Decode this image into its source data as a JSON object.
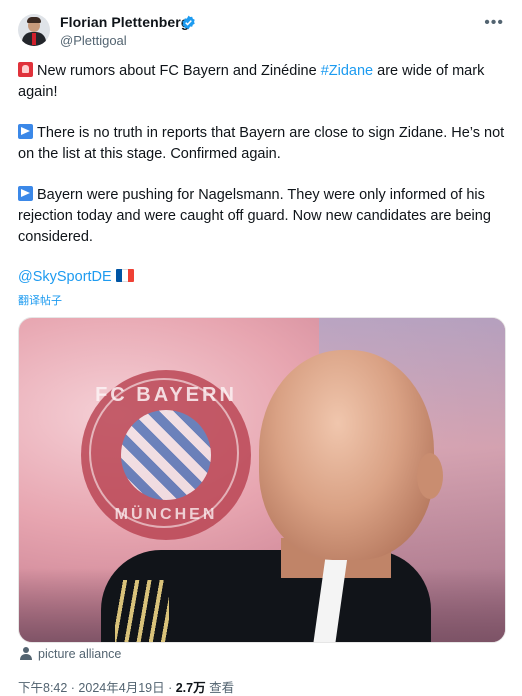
{
  "author": {
    "name": "Florian Plettenberg",
    "handle": "@Plettigoal",
    "avatar_icon": "profile-photo",
    "verified_color": "#1d9bf0"
  },
  "post": {
    "line1_pre": "New rumors about FC Bayern and Zinédine ",
    "line1_hashtag": "#Zidane",
    "line1_post": " are wide of mark again!",
    "line2": "There is no truth in reports that Bayern are close to sign Zidane. He’s not on the list at this stage. Confirmed again.",
    "line3": "Bayern were pushing for Nagelsmann. They were only informed of his rejection today and were caught off guard. Now new candidates are being considered.",
    "mention": "@SkySportDE",
    "translate_label": "翻译帖子",
    "flag_colors": [
      "#0055a4",
      "#ffffff",
      "#ef4135"
    ],
    "link_color": "#1d9bf0"
  },
  "image": {
    "logo_top": "FC BAYERN",
    "logo_bottom": "MÜNCHEN",
    "credit": "picture alliance"
  },
  "meta": {
    "time": "下午8:42 · 2024年4月19日 · ",
    "views": "2.7万",
    "views_label": " 查看"
  }
}
